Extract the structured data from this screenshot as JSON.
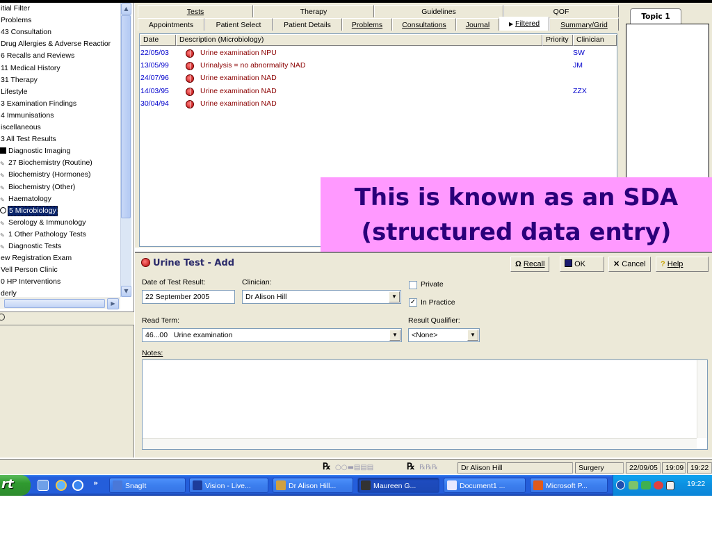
{
  "tree": {
    "items": [
      {
        "label": "itial Filter",
        "icon": "none"
      },
      {
        "label": " Problems",
        "icon": "none"
      },
      {
        "label": "43 Consultation",
        "icon": "none"
      },
      {
        "label": "Drug Allergies & Adverse Reactior",
        "icon": "none"
      },
      {
        "label": "6 Recalls and Reviews",
        "icon": "none"
      },
      {
        "label": "11 Medical History",
        "icon": "none"
      },
      {
        "label": "31 Therapy",
        "icon": "none"
      },
      {
        "label": "Lifestyle",
        "icon": "none"
      },
      {
        "label": "3 Examination Findings",
        "icon": "none"
      },
      {
        "label": "4 Immunisations",
        "icon": "none"
      },
      {
        "label": "iscellaneous",
        "icon": "none"
      },
      {
        "label": "3 All Test Results",
        "icon": "none"
      },
      {
        "label": "Diagnostic Imaging",
        "icon": "black-square"
      },
      {
        "label": "27 Biochemistry (Routine)",
        "icon": "pencil"
      },
      {
        "label": "Biochemistry (Hormones)",
        "icon": "pencil"
      },
      {
        "label": "Biochemistry (Other)",
        "icon": "pencil"
      },
      {
        "label": "Haematology",
        "icon": "pencil"
      },
      {
        "label": "5 Microbiology",
        "icon": "circle"
      },
      {
        "label": "Serology & Immunology",
        "icon": "pencil"
      },
      {
        "label": "1 Other Pathology Tests",
        "icon": "pencil"
      },
      {
        "label": "Diagnostic Tests",
        "icon": "pencil"
      },
      {
        "label": "ew Registration Exam",
        "icon": "none"
      },
      {
        "label": "Vell Person Clinic",
        "icon": "none"
      },
      {
        "label": "0 HP Interventions",
        "icon": "none"
      },
      {
        "label": "derly",
        "icon": "none"
      }
    ],
    "selected_index": 17
  },
  "tabs": {
    "row1": [
      "Tests",
      "Therapy",
      "Guidelines",
      "QOF"
    ],
    "row2": [
      "Appointments",
      "Patient Select",
      "Patient Details",
      "Problems",
      "Consultations",
      "Journal",
      "Filtered",
      "Summary/Grid"
    ]
  },
  "list": {
    "columns": [
      "Date",
      "Description (Microbiology)",
      "Priority",
      "Clinician"
    ],
    "rows": [
      {
        "date": "22/05/03",
        "description": "Urine examination NPU",
        "priority": "",
        "clinician": "SW"
      },
      {
        "date": "13/05/99",
        "description": "Urinalysis = no abnormality NAD",
        "priority": "",
        "clinician": "JM"
      },
      {
        "date": "24/07/96",
        "description": "Urine examination NAD",
        "priority": "",
        "clinician": ""
      },
      {
        "date": "14/03/95",
        "description": "Urine examination NAD",
        "priority": "",
        "clinician": "ZZX"
      },
      {
        "date": "30/04/94",
        "description": "Urine examination NAD",
        "priority": "",
        "clinician": ""
      }
    ]
  },
  "topic": {
    "tab_label": "Topic 1"
  },
  "callout": {
    "line1": "This is known as an SDA",
    "line2": "(structured data entry)"
  },
  "form": {
    "title": "Urine Test - Add",
    "buttons": {
      "recall": "Recall",
      "ok": "OK",
      "cancel": "Cancel",
      "help": "Help"
    },
    "date_label": "Date of Test Result:",
    "date_value": "22 September 2005",
    "clinician_label": "Clinician:",
    "clinician_value": "Dr Alison Hill",
    "private_label": "Private",
    "private_checked": false,
    "in_practice_label": "In Practice",
    "in_practice_checked": true,
    "read_term_label": "Read Term:",
    "read_term_value": "46...00   Urine examination",
    "result_qualifier_label": "Result Qualifier:",
    "result_qualifier_value": "<None>",
    "notes_label": "Notes:",
    "notes_value": ""
  },
  "statusbar": {
    "user": "Dr Alison Hill",
    "location": "Surgery",
    "date": "22/09/05",
    "time1": "19:09",
    "time2": "19:22"
  },
  "taskbar": {
    "start_label": "rt",
    "buttons": [
      "SnagIt",
      "Vision - Live...",
      "Dr Alison Hill...",
      "Maureen G...",
      "Document1 ...",
      "Microsoft P..."
    ],
    "active_index": 3,
    "clock": "19:22"
  },
  "colors": {
    "callout_bg": "#ff99ff",
    "callout_text": "#2a007a",
    "date_blue": "#0000cc",
    "desc_red": "#8b0000",
    "taskbar_blue": "#245edb"
  }
}
